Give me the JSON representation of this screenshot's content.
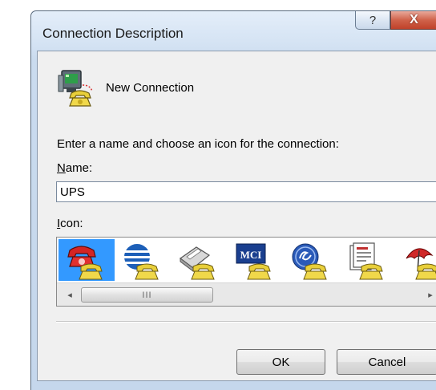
{
  "window": {
    "title": "Connection Description",
    "help_glyph": "?",
    "close_glyph": "X"
  },
  "header": {
    "icon": "connection-phone-icon",
    "label": "New Connection"
  },
  "form": {
    "prompt": "Enter a name and choose an icon for the connection:",
    "name_label_key": "N",
    "name_label_rest": "ame:",
    "name_value": "UPS",
    "icon_label_key": "I",
    "icon_label_rest": "con:"
  },
  "icon_list": {
    "items": [
      {
        "name": "red-telephone-icon",
        "selected": true
      },
      {
        "name": "blue-globe-icon",
        "selected": false
      },
      {
        "name": "fax-machine-icon",
        "selected": false
      },
      {
        "name": "mci-icon",
        "text": "MCI",
        "selected": false
      },
      {
        "name": "ge-logo-icon",
        "selected": false
      },
      {
        "name": "document-phone-icon",
        "selected": false
      },
      {
        "name": "umbrella-icon",
        "selected": false
      }
    ],
    "scroll_left_glyph": "◂",
    "scroll_right_glyph": "▸",
    "thumb_grip": "III"
  },
  "buttons": {
    "ok": "OK",
    "cancel": "Cancel"
  },
  "colors": {
    "selection": "#3399ff",
    "close_button": "#c8503a",
    "dialog_background": "#f0f0f0"
  }
}
